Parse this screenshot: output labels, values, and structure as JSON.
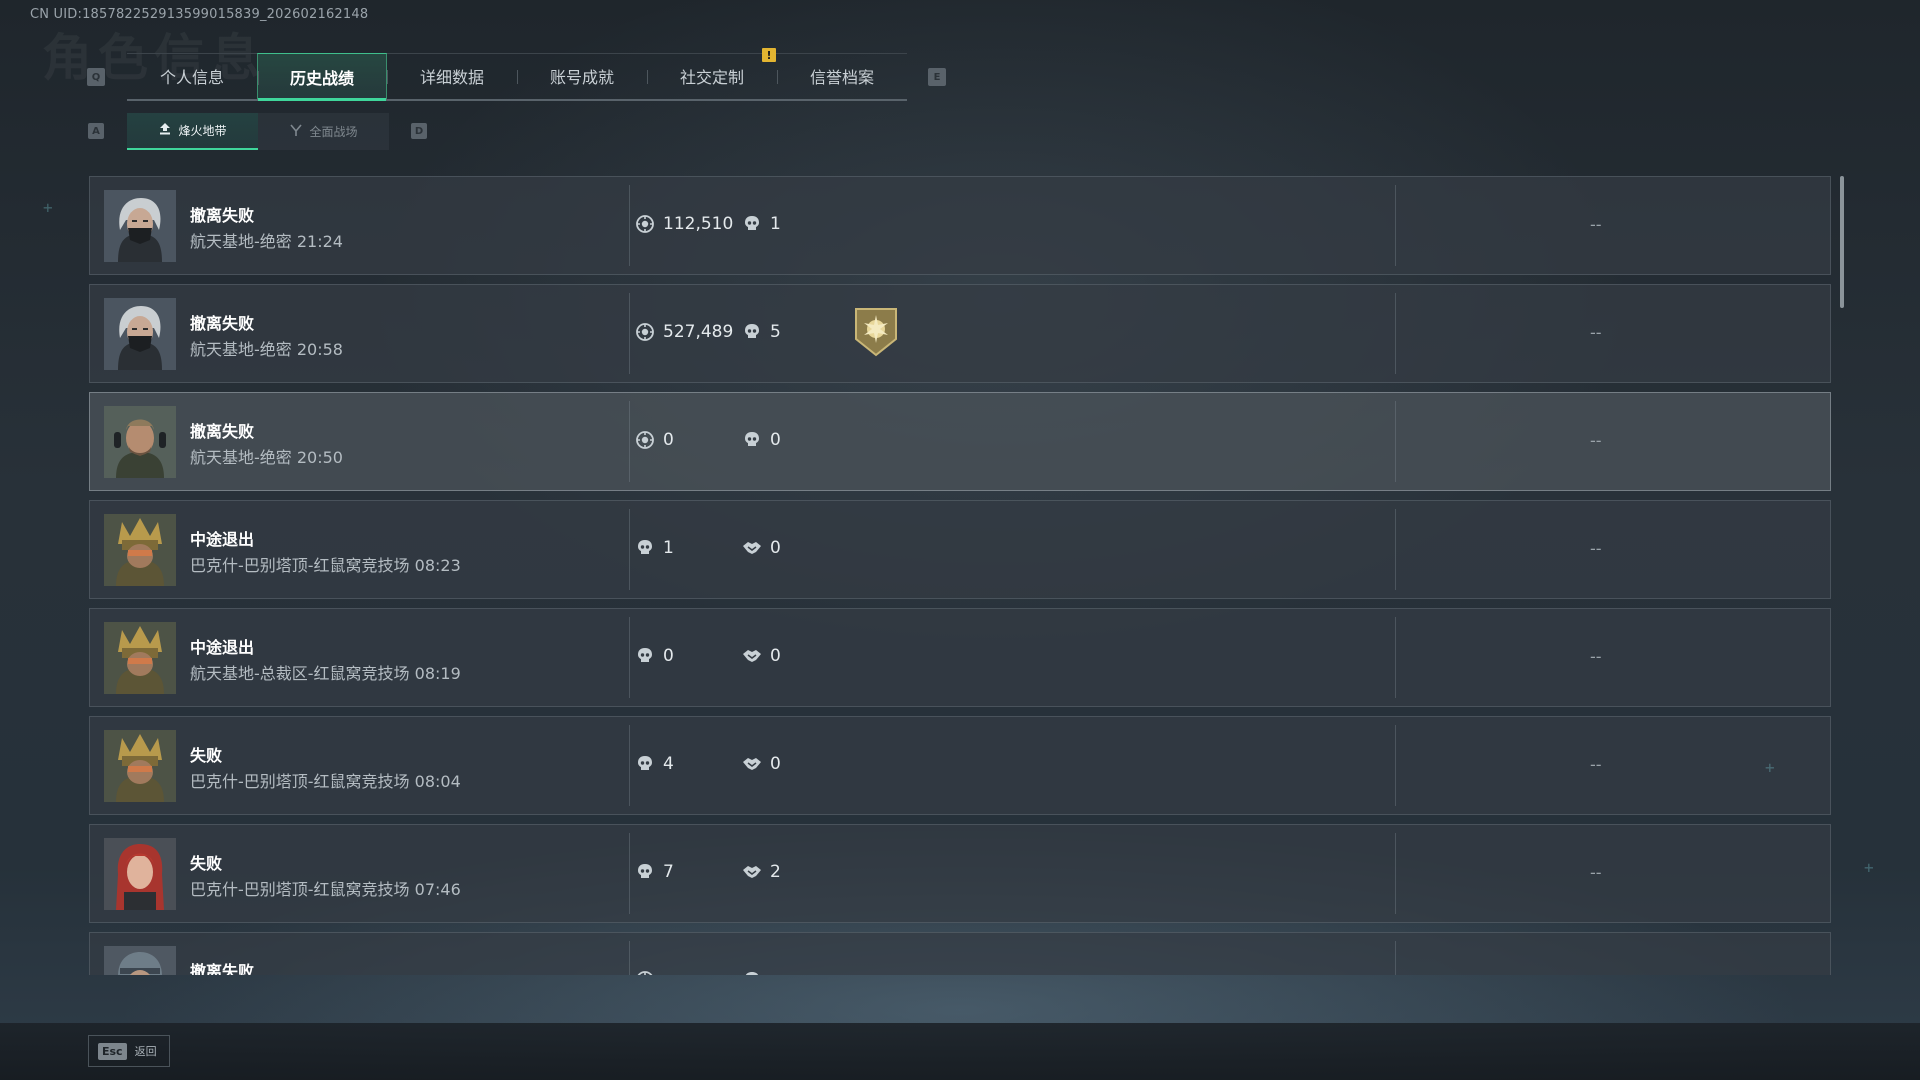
{
  "uid": "CN UID:18578225291359901583​9_202602162148",
  "ghost_title": "角色信息",
  "main_tabs": [
    {
      "label": "个人信息"
    },
    {
      "label": "历史战绩"
    },
    {
      "label": "详细数据"
    },
    {
      "label": "账号成就"
    },
    {
      "label": "社交定制"
    },
    {
      "label": "信誉档案"
    }
  ],
  "alert_badge": "!",
  "key_hints": {
    "prev_tab": "Q",
    "next_tab": "E",
    "prev_sub": "A",
    "next_sub": "D"
  },
  "sub_tabs": [
    {
      "label": "烽火地带",
      "icon": "extraction-icon"
    },
    {
      "label": "全面战场",
      "icon": "warfare-icon"
    }
  ],
  "matches": [
    {
      "result": "撤离失败",
      "map": "航天基地-绝密 21:24",
      "avatar": "masked-woman",
      "stat1_icon": "coin-icon",
      "stat1": "112,510",
      "stat2_icon": "skull-icon",
      "stat2": "1",
      "emblem": false,
      "extra": "--"
    },
    {
      "result": "撤离失败",
      "map": "航天基地-绝密 20:58",
      "avatar": "masked-woman",
      "stat1_icon": "coin-icon",
      "stat1": "527,489",
      "stat2_icon": "skull-icon",
      "stat2": "5",
      "emblem": true,
      "extra": "--"
    },
    {
      "result": "撤离失败",
      "map": "航天基地-绝密 20:50",
      "avatar": "bearded-man",
      "stat1_icon": "coin-icon",
      "stat1": "0",
      "stat2_icon": "skull-icon",
      "stat2": "0",
      "emblem": false,
      "extra": "--"
    },
    {
      "result": "中途退出",
      "map": "巴克什-巴别塔顶-红鼠窝竞技场 08:23",
      "avatar": "crowned-soldier",
      "stat1_icon": "skull-icon",
      "stat1": "1",
      "stat2_icon": "handshake-icon",
      "stat2": "0",
      "emblem": false,
      "extra": "--"
    },
    {
      "result": "中途退出",
      "map": "航天基地-总裁区-红鼠窝竞技场 08:19",
      "avatar": "crowned-soldier",
      "stat1_icon": "skull-icon",
      "stat1": "0",
      "stat2_icon": "handshake-icon",
      "stat2": "0",
      "emblem": false,
      "extra": "--"
    },
    {
      "result": "失败",
      "map": "巴克什-巴别塔顶-红鼠窝竞技场 08:04",
      "avatar": "crowned-soldier",
      "stat1_icon": "skull-icon",
      "stat1": "4",
      "stat2_icon": "handshake-icon",
      "stat2": "0",
      "emblem": false,
      "extra": "--"
    },
    {
      "result": "失败",
      "map": "巴克什-巴别塔顶-红鼠窝竞技场 07:46",
      "avatar": "red-hair-woman",
      "stat1_icon": "skull-icon",
      "stat1": "7",
      "stat2_icon": "handshake-icon",
      "stat2": "2",
      "emblem": false,
      "extra": "--"
    },
    {
      "result": "撤离失败",
      "map": "",
      "avatar": "helmet-soldier",
      "stat1_icon": "coin-icon",
      "stat1": "",
      "stat2_icon": "skull-icon",
      "stat2": "",
      "emblem": false,
      "extra": ""
    }
  ],
  "footer": {
    "esc_key": "Esc",
    "back_label": "返回"
  },
  "colors": {
    "accent": "#3fd69b",
    "alert": "#e3b531"
  }
}
